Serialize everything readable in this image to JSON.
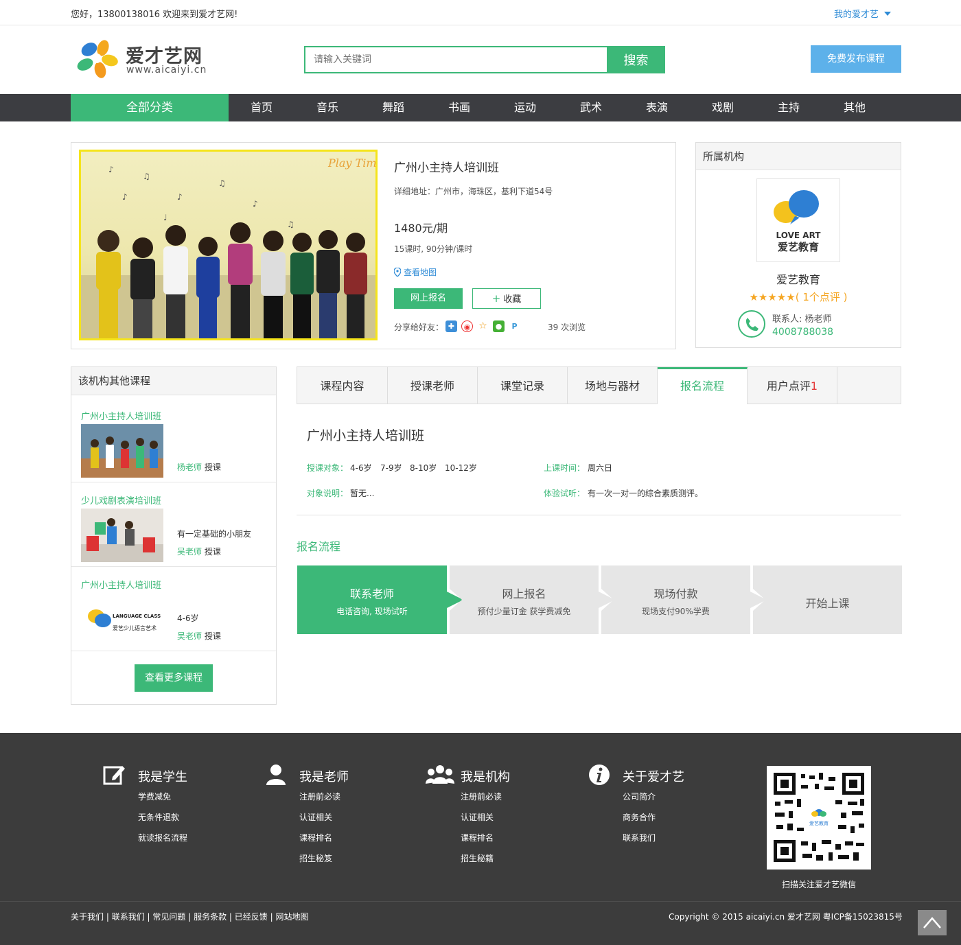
{
  "topbar": {
    "greeting": "您好，13800138016 欢迎来到爱才艺网!",
    "my_account": "我的爱才艺"
  },
  "logo": {
    "name": "爱才艺网",
    "domain": "www.aicaiyi.cn"
  },
  "search": {
    "placeholder": "请输入关键词",
    "button": "搜索"
  },
  "publish_button": "免费发布课程",
  "nav": {
    "all": "全部分类",
    "items": [
      "首页",
      "音乐",
      "舞蹈",
      "书画",
      "运动",
      "武术",
      "表演",
      "戏剧",
      "主持",
      "其他"
    ]
  },
  "course": {
    "title": "广州小主持人培训班",
    "address": "详细地址：广州市，海珠区，基利下道54号",
    "price": "1480元/期",
    "lessons": "15课时, 90分钟/课时",
    "map_link": "查看地图",
    "signup": "网上报名",
    "favorite": "收藏",
    "share_label": "分享给好友：",
    "views": "39 次浏览",
    "photo_text": "Play Time"
  },
  "org": {
    "header": "所属机构",
    "logo_en": "LOVE ART",
    "logo_cn": "爱艺教育",
    "name": "爱艺教育",
    "stars": "★★★★★",
    "reviews": "( 1个点评 )",
    "contact": "联系人: 杨老师",
    "phone": "4008788038"
  },
  "other_courses": {
    "header": "该机构其他课程",
    "items": [
      {
        "title": "广州小主持人培训班",
        "desc": "",
        "teacher": "杨老师",
        "suffix": " 授课"
      },
      {
        "title": "少儿戏剧表演培训班",
        "desc": "有一定基础的小朋友",
        "teacher": "吴老师",
        "suffix": " 授课"
      },
      {
        "title": "广州小主持人培训班",
        "desc": "4-6岁",
        "teacher": "吴老师",
        "suffix": " 授课"
      }
    ],
    "lang_logo_en": "LANGUAGE CLASS",
    "lang_logo_cn": "爱艺少儿语言艺术",
    "more": "查看更多课程"
  },
  "tabs": [
    "课程内容",
    "授课老师",
    "课堂记录",
    "场地与器材",
    "报名流程",
    "用户点评"
  ],
  "tab_review_count": "1",
  "detail": {
    "title": "广州小主持人培训班",
    "target_label": "授课对象：",
    "target_values": [
      "4-6岁",
      "7-9岁",
      "8-10岁",
      "10-12岁"
    ],
    "time_label": "上课时间：",
    "time_value": "周六日",
    "desc_label": "对象说明：",
    "desc_value": "暂无...",
    "trial_label": "体验试听：",
    "trial_value": "有一次一对一的综合素质测评。"
  },
  "flow": {
    "title": "报名流程",
    "steps": [
      {
        "title": "联系老师",
        "sub": "电话咨询, 现场试听"
      },
      {
        "title": "网上报名",
        "sub": "预付少量订金 获学费减免"
      },
      {
        "title": "现场付款",
        "sub": "现场支付90%学费"
      },
      {
        "title": "开始上课",
        "sub": ""
      }
    ],
    "active_color": "#3cb878",
    "inactive_color": "#e6e6e6"
  },
  "footer": {
    "columns": [
      {
        "title": "我是学生",
        "icon": "edit-icon",
        "links": [
          "学费减免",
          "无条件退款",
          "就读报名流程"
        ]
      },
      {
        "title": "我是老师",
        "icon": "user-icon",
        "links": [
          "注册前必读",
          "认证相关",
          "课程排名",
          "招生秘笈"
        ]
      },
      {
        "title": "我是机构",
        "icon": "group-icon",
        "links": [
          "注册前必读",
          "认证相关",
          "课程排名",
          "招生秘籍"
        ]
      },
      {
        "title": "关于爱才艺",
        "icon": "info-icon",
        "links": [
          "公司简介",
          "商务合作",
          "联系我们"
        ]
      }
    ],
    "qr_text": "扫描关注爱才艺微信",
    "qr_center": "爱艺教育",
    "bottom_links": [
      "关于我们",
      "联系我们",
      "常见问题",
      "服务条款",
      "已经反馈",
      "网站地图"
    ],
    "copyright": "Copyright © 2015 aicaiyi.cn 爱才艺网 粤ICP备15023815号"
  },
  "colors": {
    "brand_green": "#3cb878",
    "brand_blue": "#5db1ea",
    "nav_dark": "#3c3d41",
    "footer_dark": "#3c3c3c"
  }
}
